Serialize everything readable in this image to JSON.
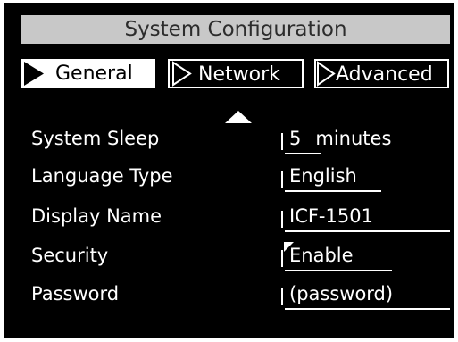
{
  "window": {
    "title": "System Configuration"
  },
  "tabs": [
    {
      "label": "General",
      "selected": true,
      "icon": "play-arrow-icon"
    },
    {
      "label": "Network",
      "selected": false,
      "icon": "play-arrow-outline-icon"
    },
    {
      "label": "Advanced",
      "selected": false,
      "icon": "play-arrow-outline-icon"
    }
  ],
  "settings": {
    "system_sleep": {
      "label": "System Sleep",
      "value": "5",
      "unit": "minutes"
    },
    "language_type": {
      "label": "Language Type",
      "value": "English"
    },
    "display_name": {
      "label": "Display Name",
      "value": "ICF-1501"
    },
    "security": {
      "label": "Security",
      "value": "Enable"
    },
    "password": {
      "label": "Password",
      "value": "(password)"
    }
  },
  "colors": {
    "background": "#000000",
    "title_bar": "#c8c8c8",
    "title_text": "#2c2c2c",
    "foreground": "#ffffff"
  }
}
